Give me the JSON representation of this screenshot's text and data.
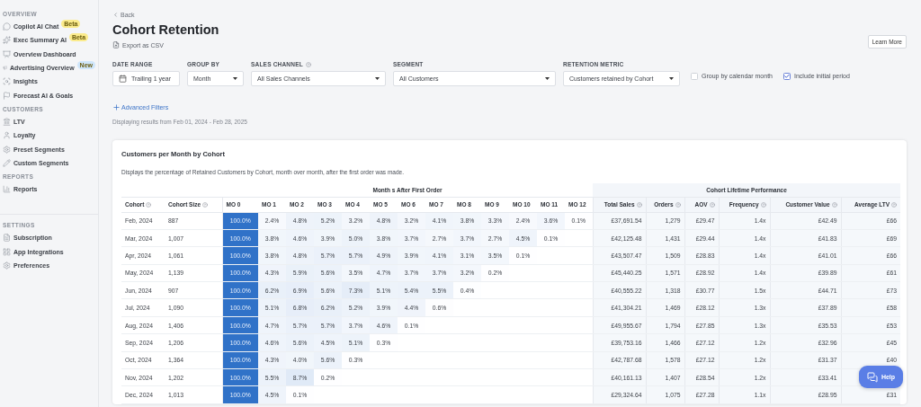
{
  "sidebar": {
    "sections": [
      {
        "title": "OVERVIEW",
        "items": [
          {
            "label": "Copilot AI Chat",
            "badge": "Beta",
            "color": "#fbeb8c"
          },
          {
            "label": "Exec Summary AI",
            "badge": "Beta",
            "color": "#fbeb8c"
          },
          {
            "label": "Overview Dashboard"
          },
          {
            "label": "Advertising Overview",
            "badge": "New",
            "color": "#cfe6fb"
          },
          {
            "label": "Insights"
          },
          {
            "label": "Forecast AI & Goals"
          }
        ]
      },
      {
        "title": "CUSTOMERS",
        "items": [
          {
            "label": "LTV"
          },
          {
            "label": "Loyalty"
          },
          {
            "label": "Preset Segments"
          },
          {
            "label": "Custom Segments"
          }
        ]
      },
      {
        "title": "REPORTS",
        "items": [
          {
            "label": "Reports"
          }
        ]
      },
      {
        "title": "SETTINGS",
        "items": [
          {
            "label": "Subscription"
          },
          {
            "label": "App Integrations"
          },
          {
            "label": "Preferences"
          }
        ]
      }
    ]
  },
  "header": {
    "back": "Back",
    "title": "Cohort Retention",
    "export": "Export as CSV",
    "learn_more": "Learn More"
  },
  "filters": {
    "controls": [
      {
        "kind": "date",
        "label": "DATE RANGE",
        "value": "Trailing 1 year"
      },
      {
        "kind": "select",
        "label": "GROUP BY",
        "value": "Month"
      },
      {
        "kind": "select",
        "label": "SALES CHANNEL",
        "value": "All Sales Channels",
        "help": true
      },
      {
        "kind": "select",
        "label": "SEGMENT",
        "value": "All Customers"
      },
      {
        "kind": "select",
        "label": "RETENTION METRIC",
        "value": "Customers retained by Cohort"
      }
    ],
    "checkboxes": [
      {
        "label": "Group by calendar month",
        "checked": false
      },
      {
        "label": "Include initial period",
        "checked": true
      }
    ],
    "advanced": "Advanced Filters",
    "range_note": "Displaying results from Feb 01, 2024 - Feb 28, 2025"
  },
  "table": {
    "title": "Customers per Month by Cohort",
    "description": "Displays the percentage of Retained Customers by Cohort, month over month, after the first order was made.",
    "group_headers": [
      "Month s After First Order",
      "Cohort Lifetime Performance"
    ],
    "columns": [
      {
        "label": "Cohort",
        "help": true
      },
      {
        "label": "Cohort Size",
        "help": true
      },
      {
        "label": "MO 0"
      },
      {
        "label": "MO 1"
      },
      {
        "label": "MO 2"
      },
      {
        "label": "MO 3"
      },
      {
        "label": "MO 4"
      },
      {
        "label": "MO 5"
      },
      {
        "label": "MO 6"
      },
      {
        "label": "MO 7"
      },
      {
        "label": "MO 8"
      },
      {
        "label": "MO 9"
      },
      {
        "label": "MO 10"
      },
      {
        "label": "MO 11"
      },
      {
        "label": "MO 12"
      },
      {
        "label": "Total Sales",
        "help": true
      },
      {
        "label": "Orders",
        "help": true
      },
      {
        "label": "AOV",
        "help": true
      },
      {
        "label": "Frequency",
        "help": true
      },
      {
        "label": "Customer Value",
        "help": true
      },
      {
        "label": "Average LTV",
        "help": true
      }
    ],
    "rows": [
      {
        "cohort": "Feb, 2024",
        "size": "887",
        "retention": [
          "100.0%",
          "2.4%",
          "4.8%",
          "5.2%",
          "3.2%",
          "4.8%",
          "3.2%",
          "4.1%",
          "3.8%",
          "3.3%",
          "2.4%",
          "3.6%",
          "0.1%"
        ],
        "lifetime": [
          "£37,691.54",
          "1,279",
          "£29.47",
          "1.4x",
          "£42.49",
          "£66"
        ]
      },
      {
        "cohort": "Mar, 2024",
        "size": "1,007",
        "retention": [
          "100.0%",
          "3.8%",
          "4.6%",
          "3.9%",
          "5.0%",
          "3.8%",
          "3.7%",
          "2.7%",
          "3.7%",
          "2.7%",
          "4.5%",
          "0.1%"
        ],
        "lifetime": [
          "£42,125.48",
          "1,431",
          "£29.44",
          "1.4x",
          "£41.83",
          "£69"
        ]
      },
      {
        "cohort": "Apr, 2024",
        "size": "1,061",
        "retention": [
          "100.0%",
          "3.8%",
          "4.8%",
          "5.7%",
          "5.7%",
          "4.9%",
          "3.9%",
          "4.1%",
          "3.1%",
          "3.5%",
          "0.1%"
        ],
        "lifetime": [
          "£43,507.47",
          "1,509",
          "£28.83",
          "1.4x",
          "£41.01",
          "£66"
        ]
      },
      {
        "cohort": "May, 2024",
        "size": "1,139",
        "retention": [
          "100.0%",
          "4.3%",
          "5.9%",
          "5.6%",
          "3.5%",
          "4.7%",
          "3.7%",
          "3.7%",
          "3.2%",
          "0.2%"
        ],
        "lifetime": [
          "£45,440.25",
          "1,571",
          "£28.92",
          "1.4x",
          "£39.89",
          "£61"
        ]
      },
      {
        "cohort": "Jun, 2024",
        "size": "907",
        "retention": [
          "100.0%",
          "6.2%",
          "6.9%",
          "5.6%",
          "7.3%",
          "5.1%",
          "5.4%",
          "5.5%",
          "0.4%"
        ],
        "lifetime": [
          "£40,555.22",
          "1,318",
          "£30.77",
          "1.5x",
          "£44.71",
          "£73"
        ]
      },
      {
        "cohort": "Jul, 2024",
        "size": "1,090",
        "retention": [
          "100.0%",
          "5.1%",
          "6.8%",
          "6.2%",
          "5.2%",
          "3.9%",
          "4.4%",
          "0.6%"
        ],
        "lifetime": [
          "£41,304.21",
          "1,469",
          "£28.12",
          "1.3x",
          "£37.89",
          "£58"
        ]
      },
      {
        "cohort": "Aug, 2024",
        "size": "1,406",
        "retention": [
          "100.0%",
          "4.7%",
          "5.7%",
          "5.7%",
          "3.7%",
          "4.6%",
          "0.1%"
        ],
        "lifetime": [
          "£49,955.67",
          "1,794",
          "£27.85",
          "1.3x",
          "£35.53",
          "£53"
        ]
      },
      {
        "cohort": "Sep, 2024",
        "size": "1,206",
        "retention": [
          "100.0%",
          "4.6%",
          "5.6%",
          "4.5%",
          "5.1%",
          "0.3%"
        ],
        "lifetime": [
          "£39,753.16",
          "1,466",
          "£27.12",
          "1.2x",
          "£32.96",
          "£45"
        ]
      },
      {
        "cohort": "Oct, 2024",
        "size": "1,364",
        "retention": [
          "100.0%",
          "4.3%",
          "4.0%",
          "5.6%",
          "0.3%"
        ],
        "lifetime": [
          "£42,787.68",
          "1,578",
          "£27.12",
          "1.2x",
          "£31.37",
          "£40"
        ]
      },
      {
        "cohort": "Nov, 2024",
        "size": "1,202",
        "retention": [
          "100.0%",
          "5.5%",
          "8.7%",
          "0.2%"
        ],
        "lifetime": [
          "£40,161.13",
          "1,407",
          "£28.54",
          "1.2x",
          "£33.41"
        ]
      },
      {
        "cohort": "Dec, 2024",
        "size": "1,013",
        "retention": [
          "100.0%",
          "4.5%",
          "0.1%"
        ],
        "lifetime": [
          "£29,324.64",
          "1,075",
          "£27.28",
          "1.1x",
          "£28.95",
          "£31"
        ]
      }
    ]
  },
  "help_button": "Help"
}
